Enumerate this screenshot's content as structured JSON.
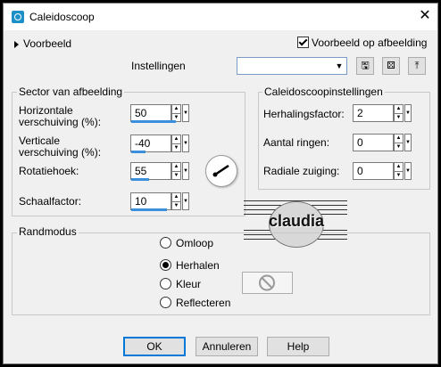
{
  "window": {
    "title": "Caleidoscoop"
  },
  "preview": {
    "toggle_label": "Voorbeeld",
    "on_image_label": "Voorbeeld op afbeelding",
    "on_image_checked": true
  },
  "presets": {
    "label": "Instellingen",
    "value": ""
  },
  "sector": {
    "title": "Sector van afbeelding",
    "h_offset_label_1": "Horizontale",
    "h_offset_label_2": "verschuiving (%):",
    "h_offset_value": "50",
    "v_offset_label_1": "Verticale",
    "v_offset_label_2": "verschuiving (%):",
    "v_offset_value": "-40",
    "rotation_label": "Rotatiehoek:",
    "rotation_value": "55",
    "scale_label": "Schaalfactor:",
    "scale_value": "10"
  },
  "kaleido": {
    "title": "Caleidoscoopinstellingen",
    "repeat_label": "Herhalingsfactor:",
    "repeat_value": "2",
    "rings_label": "Aantal ringen:",
    "rings_value": "0",
    "suction_label": "Radiale zuiging:",
    "suction_value": "0"
  },
  "edge_mode": {
    "title": "Randmodus",
    "options": [
      "Omloop",
      "Herhalen",
      "Kleur",
      "Reflecteren"
    ],
    "selected": "Herhalen"
  },
  "watermark": {
    "text": "claudia"
  },
  "buttons": {
    "ok": "OK",
    "cancel": "Annuleren",
    "help": "Help"
  }
}
